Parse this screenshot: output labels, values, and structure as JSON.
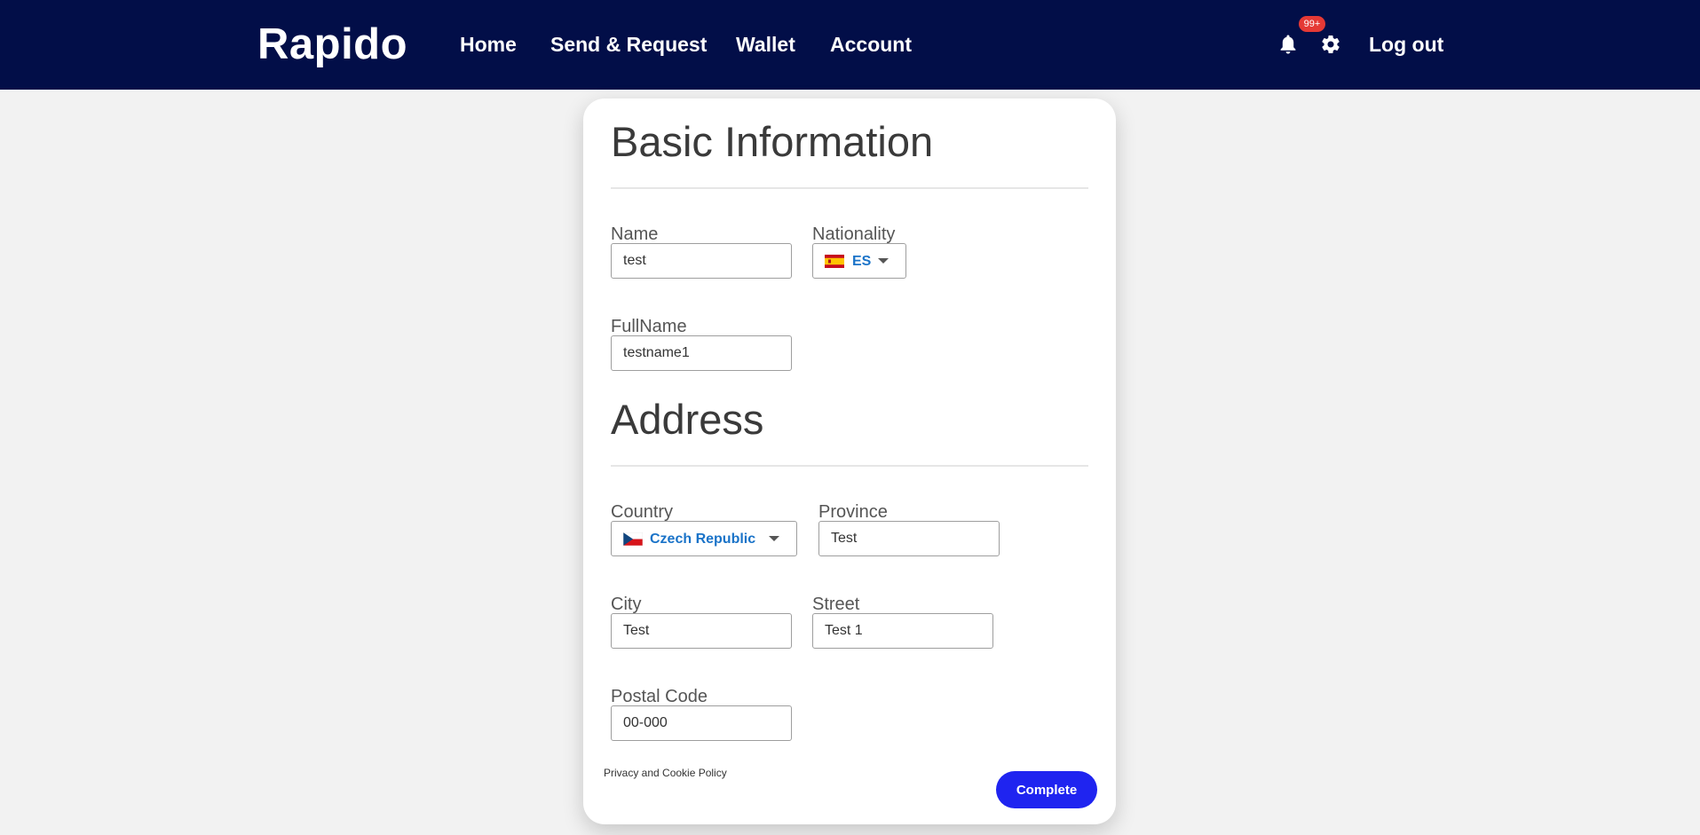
{
  "navbar": {
    "brand": "Rapido",
    "links": [
      "Home",
      "Send & Request",
      "Wallet",
      "Account"
    ],
    "notifications_badge": "99+",
    "logout_label": "Log out",
    "background_color": "#020e48",
    "icons": [
      "bell-icon",
      "gear-icon"
    ]
  },
  "basic_info": {
    "title": "Basic Information",
    "name_label": "Name",
    "name_value": "test",
    "nationality_label": "Nationality",
    "nationality_value": "ES",
    "nationality_flag": "spain-flag-icon",
    "fullname_label": "FullName",
    "fullname_value": "testname1"
  },
  "address": {
    "title": "Address",
    "country_label": "Country",
    "country_value": "Czech Republic",
    "country_flag": "czech-flag-icon",
    "province_label": "Province",
    "province_value": "Test",
    "city_label": "City",
    "city_value": "Test",
    "street_label": "Street",
    "street_value": "Test 1",
    "postal_label": "Postal Code",
    "postal_value": "00-000"
  },
  "footer": {
    "privacy_label": "Privacy and Cookie Policy",
    "complete_label": "Complete",
    "accent_color": "#1f24f0"
  }
}
